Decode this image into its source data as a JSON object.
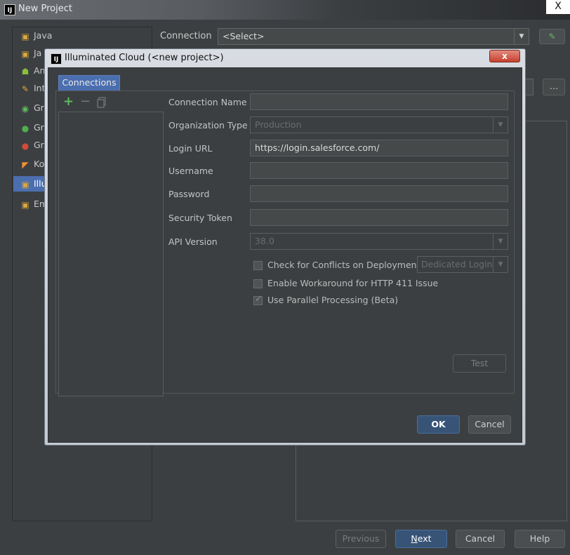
{
  "window": {
    "title": "New Project",
    "close_glyph": "X",
    "logo_text": "IJ"
  },
  "left_list": {
    "items": [
      {
        "label": "Java",
        "icon": "folder-icon",
        "color": "#d9a83e"
      },
      {
        "label": "Ja",
        "icon": "folder-icon",
        "color": "#d9a83e"
      },
      {
        "label": "An",
        "icon": "android-icon",
        "color": "#8bbf3c"
      },
      {
        "label": "Int",
        "icon": "plugin-icon",
        "color": "#d9a83e"
      },
      {
        "label": "Gr",
        "icon": "groovy-icon",
        "color": "#5fb95f"
      },
      {
        "label": "Gr",
        "icon": "grails-icon",
        "color": "#4fae4f"
      },
      {
        "label": "Gr",
        "icon": "griffon-icon",
        "color": "#d24b3a"
      },
      {
        "label": "Ko",
        "icon": "kotlin-icon",
        "color": "#f18e33"
      },
      {
        "label": "Illu",
        "icon": "folder-icon",
        "color": "#d9a83e"
      },
      {
        "label": "Em",
        "icon": "folder-icon",
        "color": "#d9a83e"
      }
    ]
  },
  "connection": {
    "label": "Connection",
    "value": "<Select>"
  },
  "bottom_buttons": {
    "previous": "Previous",
    "next_prefix": "N",
    "next_rest": "ext",
    "cancel": "Cancel",
    "help": "Help"
  },
  "dialog": {
    "title": "Illuminated Cloud (<new project>)",
    "tab": "Connections",
    "fields": {
      "connection_name": {
        "label": "Connection Name",
        "value": ""
      },
      "organization_type": {
        "label": "Organization Type",
        "value": "Production"
      },
      "login_url": {
        "label": "Login URL",
        "value": "https://login.salesforce.com/"
      },
      "username": {
        "label": "Username",
        "value": ""
      },
      "password": {
        "label": "Password",
        "value": ""
      },
      "security_token": {
        "label": "Security Token",
        "value": ""
      },
      "api_version": {
        "label": "API Version",
        "value": "38.0"
      }
    },
    "checkboxes": {
      "check_conflicts": {
        "label": "Check for Conflicts on Deployment",
        "checked": false
      },
      "http411": {
        "label": "Enable Workaround for HTTP 411 Issue",
        "checked": false
      },
      "parallel": {
        "label": "Use Parallel Processing (Beta)",
        "checked": true
      }
    },
    "dedicated_logins": "Dedicated Logins",
    "test_button": "Test",
    "ok_button": "OK",
    "cancel_button": "Cancel"
  }
}
